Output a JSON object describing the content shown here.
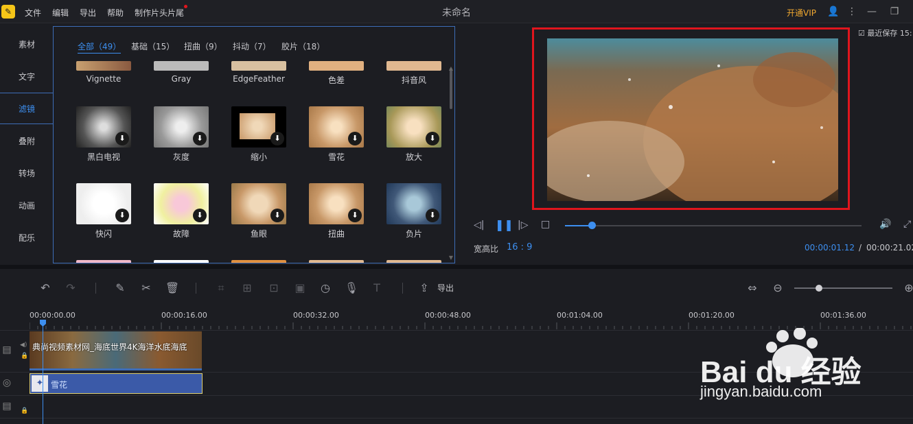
{
  "titlebar": {
    "menus": [
      "文件",
      "编辑",
      "导出",
      "帮助",
      "制作片头片尾"
    ],
    "title": "未命名",
    "vip": "开通VIP"
  },
  "nav": {
    "items": [
      "素材",
      "文字",
      "滤镜",
      "叠附",
      "转场",
      "动画",
      "配乐"
    ],
    "active": "滤镜"
  },
  "filters": {
    "tabs": [
      "全部（49）",
      "基础（15）",
      "扭曲（9）",
      "抖动（7）",
      "胶片（18）"
    ],
    "top_row_labels": [
      "Vignette",
      "Gray",
      "EdgeFeather",
      "色差",
      "抖音风"
    ],
    "row1_labels": [
      "黑白电视",
      "灰度",
      "缩小",
      "雪花",
      "放大"
    ],
    "row2_labels": [
      "快闪",
      "故障",
      "鱼眼",
      "扭曲",
      "负片"
    ],
    "download_icon": "⬇"
  },
  "preview": {
    "save_status": "最近保存 15:",
    "aspect_label": "宽高比",
    "aspect_value": "16 : 9",
    "time_current": "00:00:01.12",
    "time_separator": "/",
    "time_total": "00:00:21.02",
    "progress": 0.09
  },
  "toolbar": {
    "export_label": "导出",
    "zoom_level": 0.25
  },
  "timeline": {
    "ruler_labels": [
      "00:00:00.00",
      "00:00:16.00",
      "00:00:32.00",
      "00:00:48.00",
      "00:01:04.00",
      "00:01:20.00",
      "00:01:36.00"
    ],
    "video_clip_label": "典尚视频素材网_海底世界4K海洋水底海底",
    "filter_clip_label": "雪花"
  },
  "watermark": {
    "brand": "Bai du 经验",
    "url": "jingyan.baidu.com"
  },
  "colors": {
    "accent": "#3d8ff0",
    "highlight_frame": "#e0151d",
    "vip": "#f0a830"
  }
}
